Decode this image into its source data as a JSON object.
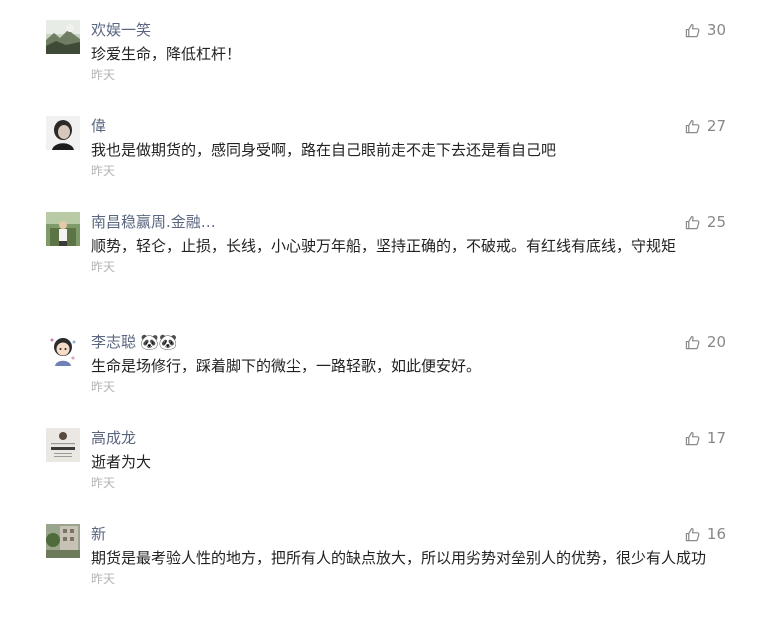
{
  "comments": [
    {
      "nickname": "欢娱一笑",
      "text": "珍爱生命，降低杠杆！",
      "time": "昨天",
      "likes": "30",
      "avatar_icon": "landscape-avatar"
    },
    {
      "nickname": "偉",
      "text": "我也是做期货的，感同身受啊，路在自己眼前走不走下去还是看自己吧",
      "time": "昨天",
      "likes": "27",
      "avatar_icon": "portrait-avatar"
    },
    {
      "nickname": "南昌稳赢周.金融…",
      "text": "顺势，轻仑，止损，长线，小心驶万年船，坚持正确的，不破戒。有红线有底线，守规矩",
      "time": "昨天",
      "likes": "25",
      "avatar_icon": "person-outdoor-avatar"
    },
    {
      "nickname": "李志聪",
      "badge": "🐼🐼",
      "text": "生命是场修行，踩着脚下的微尘，一路轻歌，如此便安好。",
      "time": "昨天",
      "likes": "20",
      "avatar_icon": "cartoon-avatar"
    },
    {
      "nickname": "高成龙",
      "text": "逝者为大",
      "time": "昨天",
      "likes": "17",
      "avatar_icon": "book-cover-avatar"
    },
    {
      "nickname": "新",
      "text": "期货是最考验人性的地方，把所有人的缺点放大，所以用劣势对垒别人的优势，很少有人成功",
      "time": "昨天",
      "likes": "16",
      "avatar_icon": "building-avatar"
    }
  ],
  "colors": {
    "nickname": "#5b6680",
    "text": "#222222",
    "time": "#b4b4b4",
    "likes": "#888888"
  }
}
